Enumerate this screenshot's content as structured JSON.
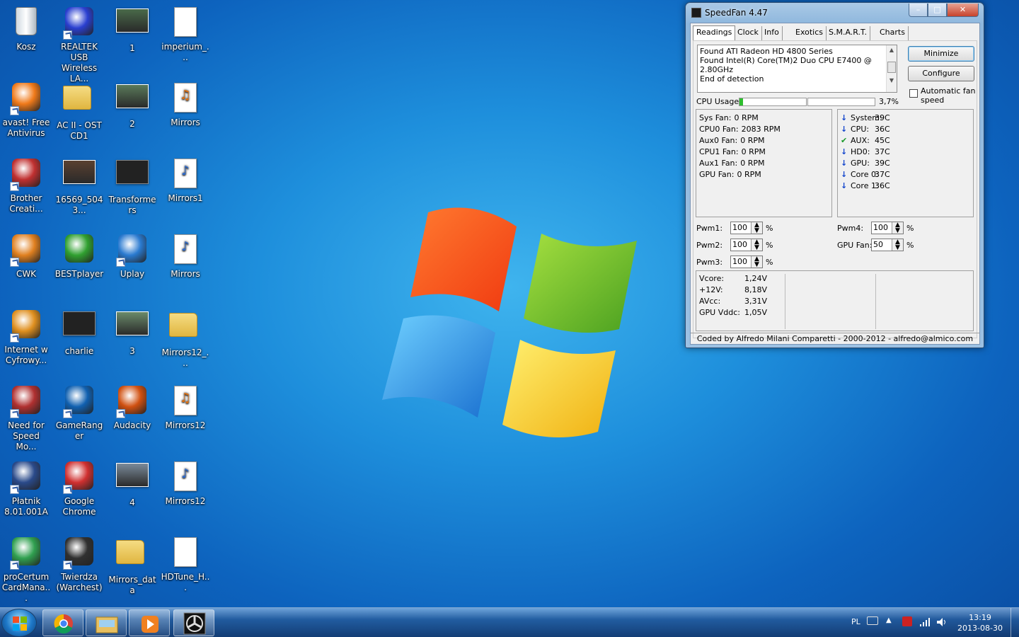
{
  "desktop": {
    "icons": [
      {
        "label": "Kosz",
        "kind": "bin",
        "col": 0,
        "row": 0,
        "shortcut": false
      },
      {
        "label": "REALTEK USB Wireless LA...",
        "kind": "app",
        "color": "#2a3fd0",
        "col": 1,
        "row": 0,
        "shortcut": true
      },
      {
        "label": "1",
        "kind": "thumb",
        "color": "#4a6a4a",
        "col": 2,
        "row": 0,
        "shortcut": false
      },
      {
        "label": "imperium_...",
        "kind": "page",
        "col": 3,
        "row": 0,
        "shortcut": false
      },
      {
        "label": "avast! Free Antivirus",
        "kind": "app",
        "color": "#f07a1a",
        "col": 0,
        "row": 1,
        "shortcut": true
      },
      {
        "label": "AC II - OST CD1",
        "kind": "folder",
        "col": 1,
        "row": 1,
        "shortcut": false
      },
      {
        "label": "2",
        "kind": "thumb",
        "color": "#5a7a5a",
        "col": 2,
        "row": 1,
        "shortcut": false
      },
      {
        "label": "Mirrors",
        "kind": "audio",
        "col": 3,
        "row": 1,
        "shortcut": false
      },
      {
        "label": "Brother Creati...",
        "kind": "app",
        "color": "#c03030",
        "col": 0,
        "row": 2,
        "shortcut": true
      },
      {
        "label": "16569_5043...",
        "kind": "thumb",
        "color": "#5a4030",
        "col": 1,
        "row": 2,
        "shortcut": false
      },
      {
        "label": "Transformers",
        "kind": "video",
        "col": 2,
        "row": 2,
        "shortcut": false
      },
      {
        "label": "Mirrors1",
        "kind": "mp3",
        "col": 3,
        "row": 2,
        "shortcut": false
      },
      {
        "label": "CWK",
        "kind": "app",
        "color": "#e08020",
        "col": 0,
        "row": 3,
        "shortcut": true
      },
      {
        "label": "BESTplayer",
        "kind": "app",
        "color": "#30a030",
        "col": 1,
        "row": 3,
        "shortcut": false
      },
      {
        "label": "Uplay",
        "kind": "app",
        "color": "#2a7ad0",
        "col": 2,
        "row": 3,
        "shortcut": true
      },
      {
        "label": "Mirrors",
        "kind": "mp3",
        "col": 3,
        "row": 3,
        "shortcut": false
      },
      {
        "label": "Internet w Cyfrowy...",
        "kind": "app",
        "color": "#e09020",
        "col": 0,
        "row": 4,
        "shortcut": true
      },
      {
        "label": "charlie",
        "kind": "video",
        "col": 1,
        "row": 4,
        "shortcut": false
      },
      {
        "label": "3",
        "kind": "thumb",
        "color": "#6a8a6a",
        "col": 2,
        "row": 4,
        "shortcut": false
      },
      {
        "label": "Mirrors12_...",
        "kind": "folder",
        "col": 3,
        "row": 4,
        "shortcut": false
      },
      {
        "label": "Need for Speed Mo...",
        "kind": "app",
        "color": "#b03030",
        "col": 0,
        "row": 5,
        "shortcut": true
      },
      {
        "label": "GameRanger",
        "kind": "app",
        "color": "#1060b0",
        "col": 1,
        "row": 5,
        "shortcut": true
      },
      {
        "label": "Audacity",
        "kind": "app",
        "color": "#d05010",
        "col": 2,
        "row": 5,
        "shortcut": true
      },
      {
        "label": "Mirrors12",
        "kind": "audio",
        "col": 3,
        "row": 5,
        "shortcut": false
      },
      {
        "label": "Płatnik 8.01.001A",
        "kind": "app",
        "color": "#2a4a8a",
        "col": 0,
        "row": 6,
        "shortcut": true
      },
      {
        "label": "Google Chrome",
        "kind": "app",
        "color": "#d03030",
        "col": 1,
        "row": 6,
        "shortcut": true
      },
      {
        "label": "4",
        "kind": "thumb",
        "color": "#7a8a9a",
        "col": 2,
        "row": 6,
        "shortcut": false
      },
      {
        "label": "Mirrors12",
        "kind": "mp3",
        "col": 3,
        "row": 6,
        "shortcut": false
      },
      {
        "label": "proCertum CardMana...",
        "kind": "app",
        "color": "#30a050",
        "col": 0,
        "row": 7,
        "shortcut": true
      },
      {
        "label": "Twierdza (Warchest)",
        "kind": "app",
        "color": "#303030",
        "col": 1,
        "row": 7,
        "shortcut": true
      },
      {
        "label": "Mirrors_data",
        "kind": "folder",
        "col": 2,
        "row": 7,
        "shortcut": false
      },
      {
        "label": "HDTune_H...",
        "kind": "page",
        "col": 3,
        "row": 7,
        "shortcut": false
      }
    ]
  },
  "speedfan": {
    "title": "SpeedFan 4.47",
    "controls": {
      "minimize": "–",
      "maximize": "□",
      "close": "✕"
    },
    "tabs": [
      "Readings",
      "Clock",
      "Info",
      "Exotics",
      "S.M.A.R.T.",
      "Charts"
    ],
    "active_tab": "Readings",
    "log": [
      "Found ATI Radeon HD 4800 Series",
      "Found Intel(R) Core(TM)2 Duo CPU E7400 @ 2.80GHz",
      "End of detection"
    ],
    "buttons": {
      "minimize": "Minimize",
      "configure": "Configure"
    },
    "auto_fan_label": "Automatic fan speed",
    "cpu_usage_label": "CPU Usage",
    "cpu_usage_value": "3,7%",
    "cpu_usage_bars": [
      0.05,
      0.0
    ],
    "fans": [
      {
        "label": "Sys Fan:",
        "value": "0 RPM"
      },
      {
        "label": "CPU0 Fan:",
        "value": "2083 RPM"
      },
      {
        "label": "Aux0 Fan:",
        "value": "0 RPM"
      },
      {
        "label": "CPU1 Fan:",
        "value": "0 RPM"
      },
      {
        "label": "Aux1 Fan:",
        "value": "0 RPM"
      },
      {
        "label": "GPU Fan:",
        "value": "0 RPM"
      }
    ],
    "temps": [
      {
        "label": "System:",
        "value": "39C",
        "state": "down"
      },
      {
        "label": "CPU:",
        "value": "36C",
        "state": "down"
      },
      {
        "label": "AUX:",
        "value": "45C",
        "state": "ok"
      },
      {
        "label": "HD0:",
        "value": "37C",
        "state": "down"
      },
      {
        "label": "GPU:",
        "value": "39C",
        "state": "down"
      },
      {
        "label": "Core 0:",
        "value": "37C",
        "state": "down"
      },
      {
        "label": "Core 1:",
        "value": "36C",
        "state": "down"
      }
    ],
    "pwm_left": [
      {
        "label": "Pwm1:",
        "value": "100",
        "unit": "%"
      },
      {
        "label": "Pwm2:",
        "value": "100",
        "unit": "%"
      },
      {
        "label": "Pwm3:",
        "value": "100",
        "unit": "%"
      }
    ],
    "pwm_right": [
      {
        "label": "Pwm4:",
        "value": "100",
        "unit": "%"
      },
      {
        "label": "GPU Fan:",
        "value": "50",
        "unit": "%"
      }
    ],
    "voltages": [
      {
        "label": "Vcore:",
        "value": "1,24V"
      },
      {
        "label": "+12V:",
        "value": "8,18V"
      },
      {
        "label": "AVcc:",
        "value": "3,31V"
      },
      {
        "label": "GPU Vddc:",
        "value": "1,05V"
      }
    ],
    "status": "Coded by Alfredo Milani Comparetti - 2000-2012 - alfredo@almico.com"
  },
  "taskbar": {
    "items": [
      "chrome",
      "explorer",
      "media-player",
      "speedfan"
    ],
    "language": "PL",
    "time": "13:19",
    "date": "2013-08-30"
  },
  "colors": {
    "accent": "#1e8fdc"
  }
}
